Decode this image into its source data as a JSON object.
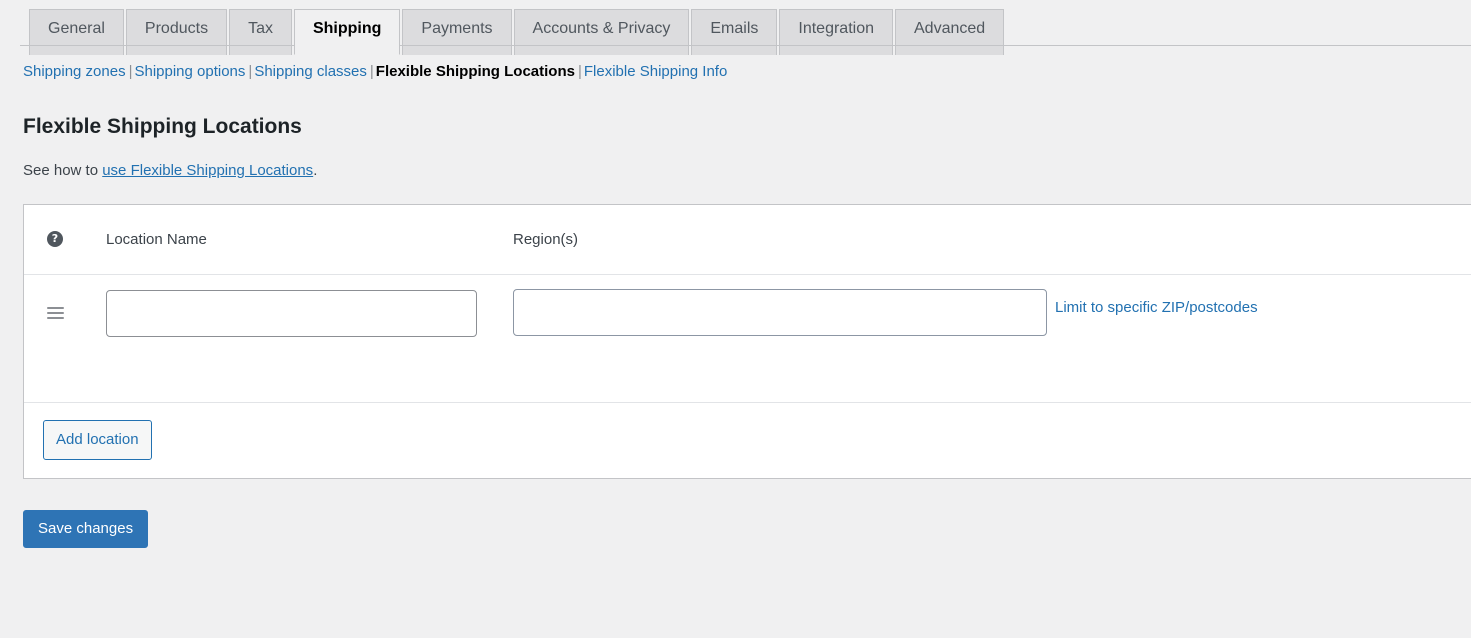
{
  "tabs": [
    {
      "label": "General",
      "active": false
    },
    {
      "label": "Products",
      "active": false
    },
    {
      "label": "Tax",
      "active": false
    },
    {
      "label": "Shipping",
      "active": true
    },
    {
      "label": "Payments",
      "active": false
    },
    {
      "label": "Accounts & Privacy",
      "active": false
    },
    {
      "label": "Emails",
      "active": false
    },
    {
      "label": "Integration",
      "active": false
    },
    {
      "label": "Advanced",
      "active": false
    }
  ],
  "subnav": {
    "separator": "|",
    "items": [
      {
        "label": "Shipping zones",
        "current": false
      },
      {
        "label": "Shipping options",
        "current": false
      },
      {
        "label": "Shipping classes",
        "current": false
      },
      {
        "label": "Flexible Shipping Locations",
        "current": true
      },
      {
        "label": "Flexible Shipping Info",
        "current": false
      }
    ]
  },
  "page": {
    "title": "Flexible Shipping Locations",
    "intro_prefix": "See how to ",
    "intro_link": "use Flexible Shipping Locations",
    "intro_suffix": "."
  },
  "table": {
    "help_icon": "question-mark-icon",
    "help_icon_glyph": "?",
    "columns": {
      "location_name": "Location Name",
      "regions": "Region(s)"
    },
    "rows": [
      {
        "handle_icon": "drag-handle-icon",
        "location_name_value": "",
        "location_name_placeholder": "",
        "regions_value": "",
        "regions_placeholder": "",
        "zip_link": "Limit to specific ZIP/postcodes"
      }
    ],
    "add_location_label": "Add location"
  },
  "footer": {
    "save_label": "Save changes"
  },
  "colors": {
    "accent_link": "#2271b1",
    "primary_button": "#2e74b5",
    "page_background": "#f0f0f1",
    "card_background": "#ffffff",
    "tab_inactive": "#dcdcde",
    "border": "#c3c4c7"
  }
}
